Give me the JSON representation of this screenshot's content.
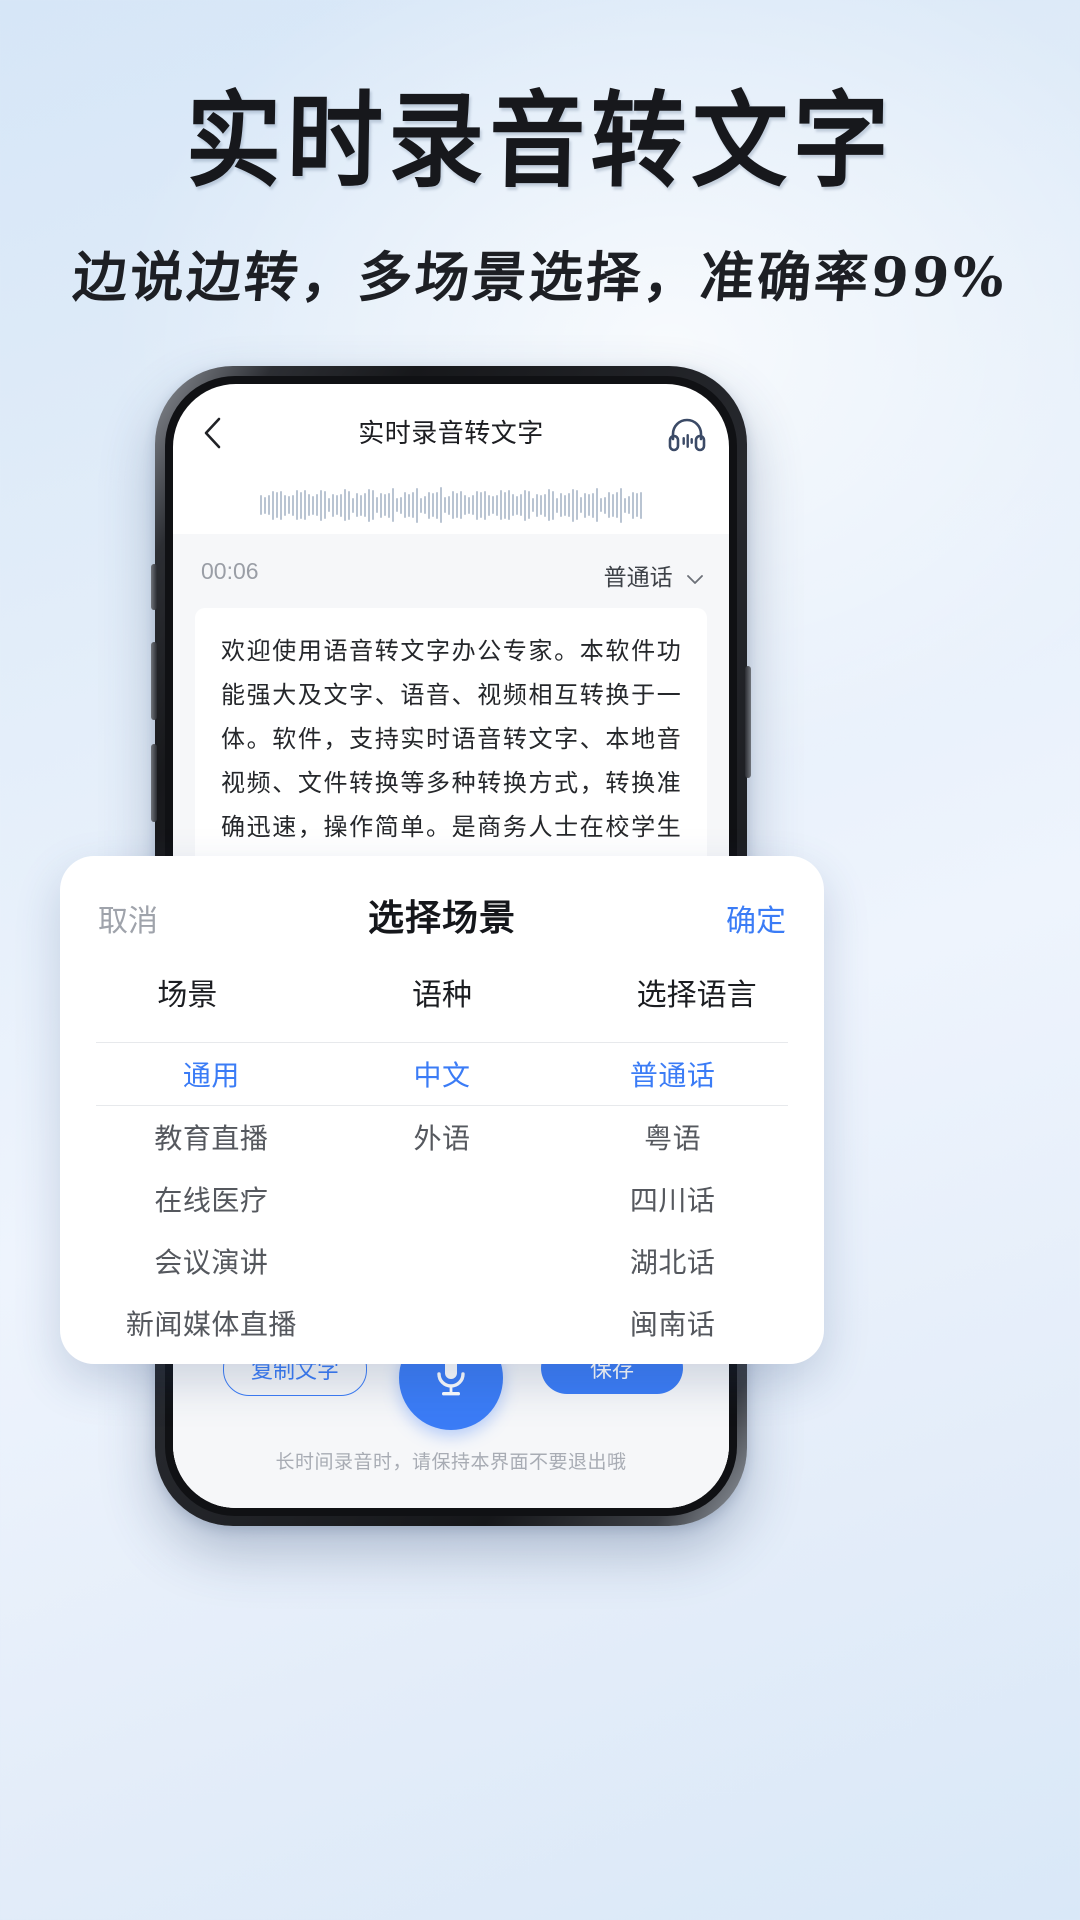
{
  "poster": {
    "headline": "实时录音转文字",
    "subhead": "边说边转，多场景选择，准确率99%",
    "accent_color": "#3b7cf6",
    "bg_top_color": "#d6e6f7",
    "bg_bottom_color": "#d9e8f8"
  },
  "app": {
    "header": {
      "back_icon": "chevron-left-icon",
      "title": "实时录音转文字",
      "headphone_icon": "headphone-icon"
    },
    "waveform": {
      "icon": "audio-waveform"
    },
    "meta": {
      "time": "00:06",
      "language": "普通话",
      "caret_icon": "chevron-down-icon"
    },
    "transcript": "欢迎使用语音转文字办公专家。本软件功能强大及文字、语音、视频相互转换于一体。软件，支持实时语音转文字、本地音视频、文件转换等多种转换方式，转换准确迅速，操作简单。是商务人士在校学生个体工商业者、促进旅游必不可少的好帮手。",
    "bottom": {
      "copy_label": "复制文字",
      "mic_icon": "microphone-icon",
      "save_label": "保存",
      "tip": "长时间录音时，请保持本界面不要退出哦"
    }
  },
  "sheet": {
    "cancel_label": "取消",
    "title": "选择场景",
    "confirm_label": "确定",
    "columns": [
      "场景",
      "语种",
      "选择语言"
    ],
    "rows": [
      {
        "scene": "通用",
        "lang_type": "中文",
        "language": "普通话",
        "selected": true
      },
      {
        "scene": "教育直播",
        "lang_type": "外语",
        "language": "粤语",
        "selected": false
      },
      {
        "scene": "在线医疗",
        "lang_type": "",
        "language": "四川话",
        "selected": false
      },
      {
        "scene": "会议演讲",
        "lang_type": "",
        "language": "湖北话",
        "selected": false
      },
      {
        "scene": "新闻媒体直播",
        "lang_type": "",
        "language": "闽南话",
        "selected": false
      }
    ]
  }
}
